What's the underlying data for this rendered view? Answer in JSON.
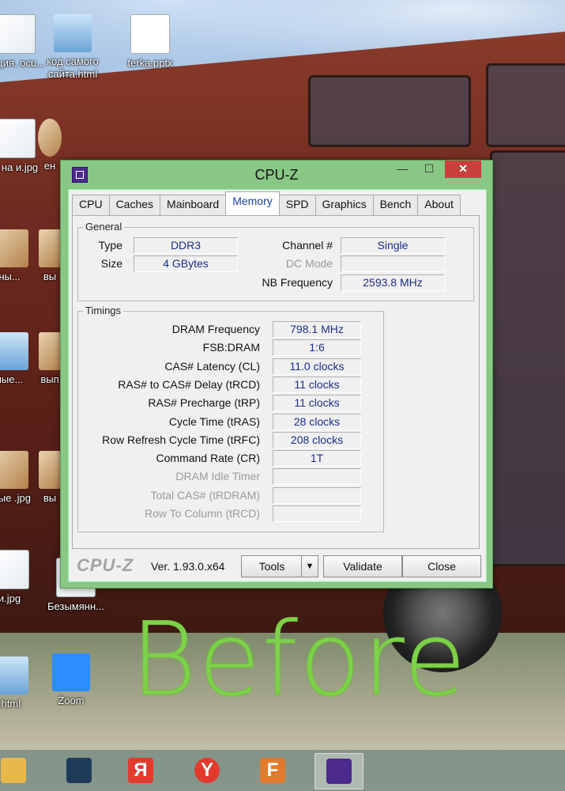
{
  "window": {
    "title": "CPU-Z",
    "controls": {
      "minimize": "—",
      "maximize": "☐",
      "close": "✕"
    },
    "tabs": [
      "CPU",
      "Caches",
      "Mainboard",
      "Memory",
      "SPD",
      "Graphics",
      "Bench",
      "About"
    ],
    "active_tab": "Memory",
    "general": {
      "title": "General",
      "type_label": "Type",
      "type_value": "DDR3",
      "size_label": "Size",
      "size_value": "4 GBytes",
      "channel_label": "Channel #",
      "channel_value": "Single",
      "dcmode_label": "DC Mode",
      "dcmode_value": "",
      "nbfreq_label": "NB Frequency",
      "nbfreq_value": "2593.8 MHz"
    },
    "timings": {
      "title": "Timings",
      "rows": [
        {
          "label": "DRAM Frequency",
          "value": "798.1 MHz",
          "dim": false
        },
        {
          "label": "FSB:DRAM",
          "value": "1:6",
          "dim": false
        },
        {
          "label": "CAS# Latency (CL)",
          "value": "11.0 clocks",
          "dim": false
        },
        {
          "label": "RAS# to CAS# Delay (tRCD)",
          "value": "11 clocks",
          "dim": false
        },
        {
          "label": "RAS# Precharge (tRP)",
          "value": "11 clocks",
          "dim": false
        },
        {
          "label": "Cycle Time (tRAS)",
          "value": "28 clocks",
          "dim": false
        },
        {
          "label": "Row Refresh Cycle Time (tRFC)",
          "value": "208 clocks",
          "dim": false
        },
        {
          "label": "Command Rate (CR)",
          "value": "1T",
          "dim": false
        },
        {
          "label": "DRAM Idle Timer",
          "value": "",
          "dim": true
        },
        {
          "label": "Total CAS# (tRDRAM)",
          "value": "",
          "dim": true
        },
        {
          "label": "Row To Column (tRCD)",
          "value": "",
          "dim": true
        }
      ]
    },
    "footer": {
      "brand": "CPU-Z",
      "version": "Ver. 1.93.0.x64",
      "tools_label": "Tools",
      "tools_arrow": "▼",
      "validate_label": "Validate",
      "close_label": "Close"
    }
  },
  "desktop": {
    "icons": [
      {
        "label": "тация. ocu...",
        "kind": "doc"
      },
      {
        "label": "код самого сайта.html",
        "kind": "notepad"
      },
      {
        "label": "terka.pptx",
        "kind": "pptx"
      },
      {
        "label": "с на и.jpg",
        "kind": "doc"
      },
      {
        "label": "ен",
        "kind": "photo"
      },
      {
        "label": "ны...",
        "kind": "photo"
      },
      {
        "label": "вы",
        "kind": "photo"
      },
      {
        "label": "ные...",
        "kind": "notepad"
      },
      {
        "label": "вып",
        "kind": "photo"
      },
      {
        "label": "кные .jpg",
        "kind": "photo"
      },
      {
        "label": "вы",
        "kind": "photo"
      },
      {
        "label": "и.jpg",
        "kind": "photo"
      },
      {
        "label": "Безымянн...",
        "kind": "doc"
      },
      {
        "label": ".html",
        "kind": "notepad"
      },
      {
        "label": "Zoom",
        "kind": "zoom"
      }
    ],
    "overlay_text": "Before"
  },
  "taskbar": {
    "apps": [
      {
        "name": "file-explorer-icon",
        "glyph": "",
        "color": "#e8b84a"
      },
      {
        "name": "ms-store-icon",
        "glyph": "",
        "color": "#1f3b5c"
      },
      {
        "name": "yandex-browser-icon",
        "glyph": "Я",
        "color": "#e23b2e"
      },
      {
        "name": "yandex-icon",
        "glyph": "Y",
        "color": "#e23b2e"
      },
      {
        "name": "fences-icon",
        "glyph": "F",
        "color": "#e07a2d"
      },
      {
        "name": "cpuz-icon",
        "glyph": "",
        "color": "#4b2a8c"
      }
    ]
  }
}
